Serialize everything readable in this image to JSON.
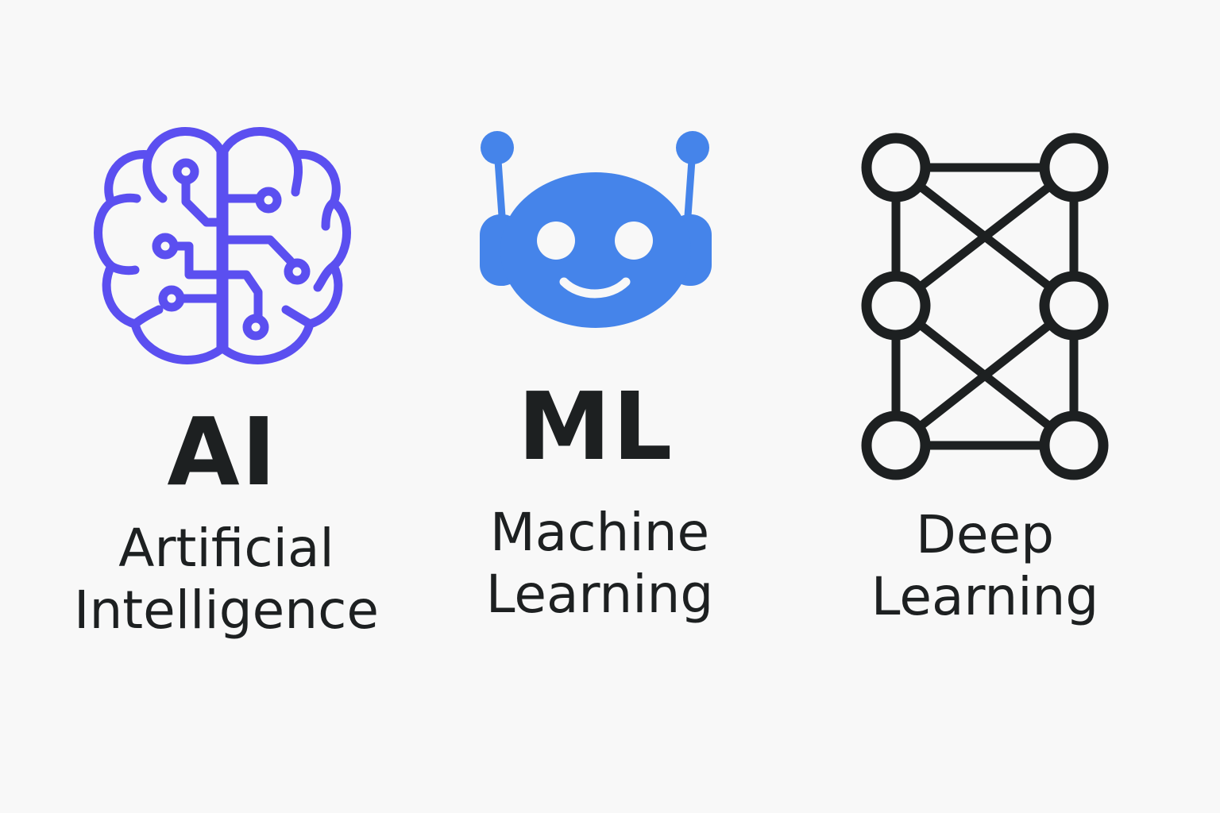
{
  "items": [
    {
      "abbreviation": "AI",
      "name_lines": [
        "Artificial",
        "Intelligence"
      ],
      "icon": "brain-circuit-icon",
      "color": "#5b4ff0"
    },
    {
      "abbreviation": "ML",
      "name_lines": [
        "Machine",
        "Learning"
      ],
      "icon": "robot-head-icon",
      "color": "#4584ea"
    },
    {
      "abbreviation": "",
      "name_lines": [
        "Deep",
        "Learning"
      ],
      "icon": "neural-network-icon",
      "color": "#1d2021"
    }
  ]
}
